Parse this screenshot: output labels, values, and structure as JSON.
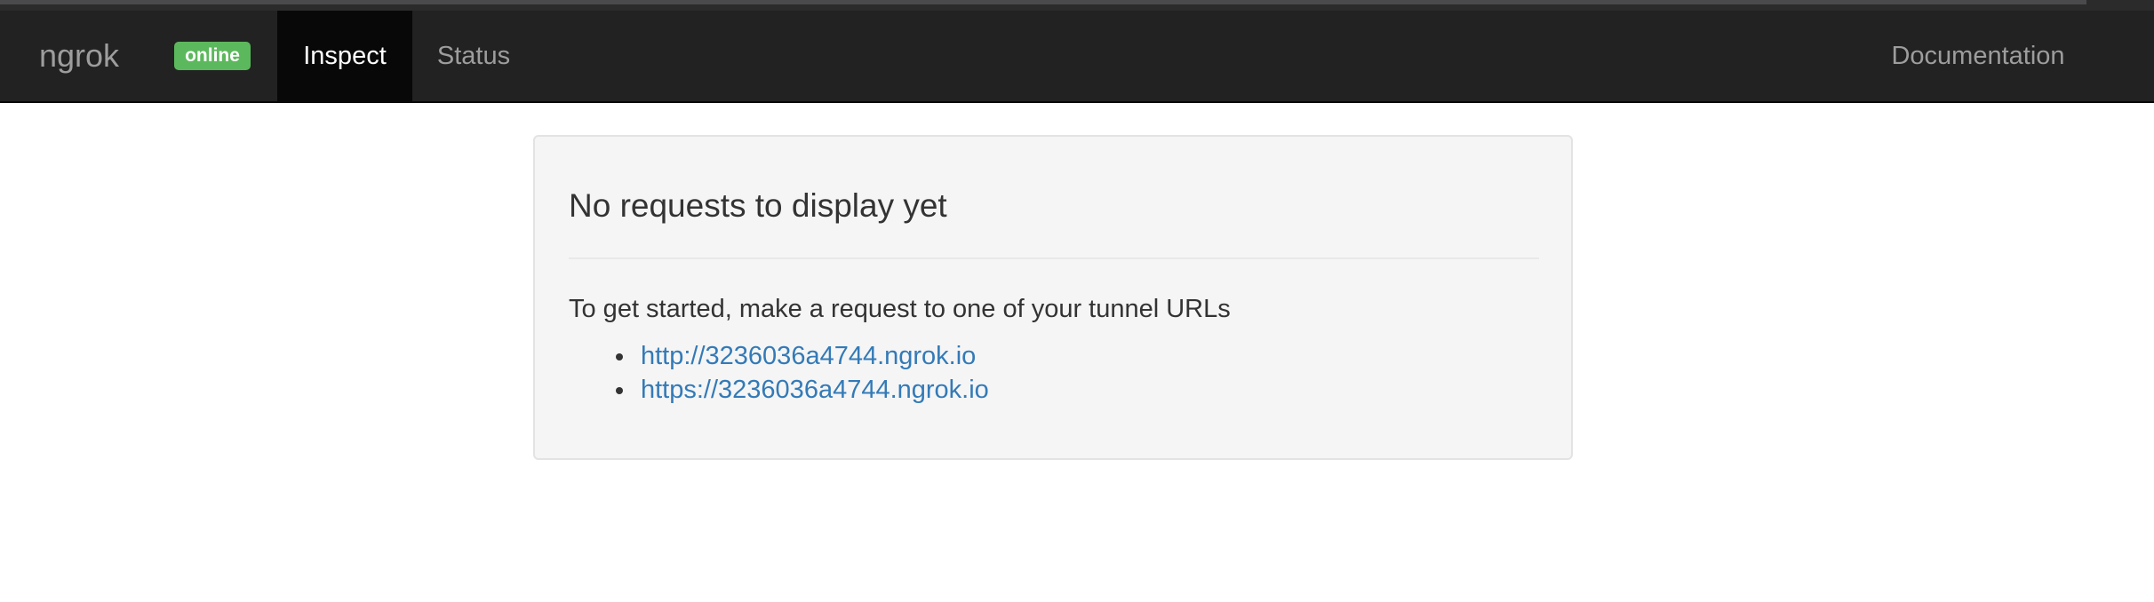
{
  "navbar": {
    "brand": "ngrok",
    "status_badge": "online",
    "tabs": [
      {
        "label": "Inspect",
        "active": true
      },
      {
        "label": "Status",
        "active": false
      }
    ],
    "documentation_link": "Documentation"
  },
  "main": {
    "heading": "No requests to display yet",
    "instructions": "To get started, make a request to one of your tunnel URLs",
    "tunnel_urls": [
      "http://3236036a4744.ngrok.io",
      "https://3236036a4744.ngrok.io"
    ]
  },
  "colors": {
    "navbar_bg": "#222222",
    "active_tab_bg": "#080808",
    "badge_green": "#5cb85c",
    "link_blue": "#337ab7",
    "panel_bg": "#f5f5f5"
  }
}
